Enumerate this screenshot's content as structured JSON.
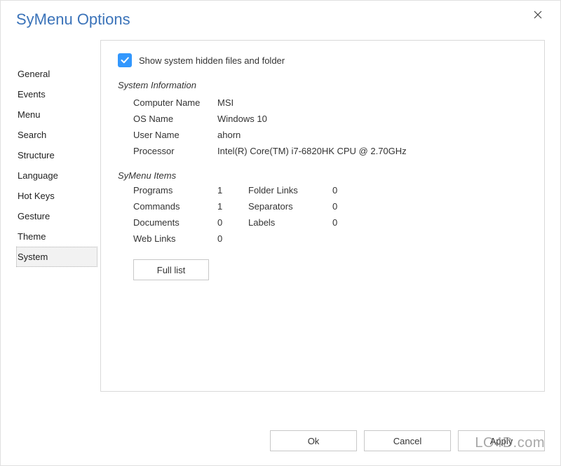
{
  "title": "SyMenu Options",
  "sidebar": {
    "items": [
      {
        "label": "General"
      },
      {
        "label": "Events"
      },
      {
        "label": "Menu"
      },
      {
        "label": "Search"
      },
      {
        "label": "Structure"
      },
      {
        "label": "Language"
      },
      {
        "label": "Hot Keys"
      },
      {
        "label": "Gesture"
      },
      {
        "label": "Theme"
      },
      {
        "label": "System",
        "selected": true
      }
    ]
  },
  "panel": {
    "show_hidden_label": "Show system hidden files and folder",
    "show_hidden_checked": true,
    "sysinfo_header": "System Information",
    "sysinfo": [
      {
        "label": "Computer Name",
        "value": "MSI"
      },
      {
        "label": "OS Name",
        "value": "Windows 10"
      },
      {
        "label": "User Name",
        "value": "ahorn"
      },
      {
        "label": "Processor",
        "value": "Intel(R) Core(TM) i7-6820HK CPU @ 2.70GHz"
      }
    ],
    "items_header": "SyMenu Items",
    "items": {
      "programs_label": "Programs",
      "programs_value": "1",
      "folderlinks_label": "Folder Links",
      "folderlinks_value": "0",
      "commands_label": "Commands",
      "commands_value": "1",
      "separators_label": "Separators",
      "separators_value": "0",
      "documents_label": "Documents",
      "documents_value": "0",
      "labels_label": "Labels",
      "labels_value": "0",
      "weblinks_label": "Web Links",
      "weblinks_value": "0"
    },
    "full_list_label": "Full list"
  },
  "buttons": {
    "ok": "Ok",
    "cancel": "Cancel",
    "apply": "Apply"
  },
  "watermark": "LO4D.com"
}
